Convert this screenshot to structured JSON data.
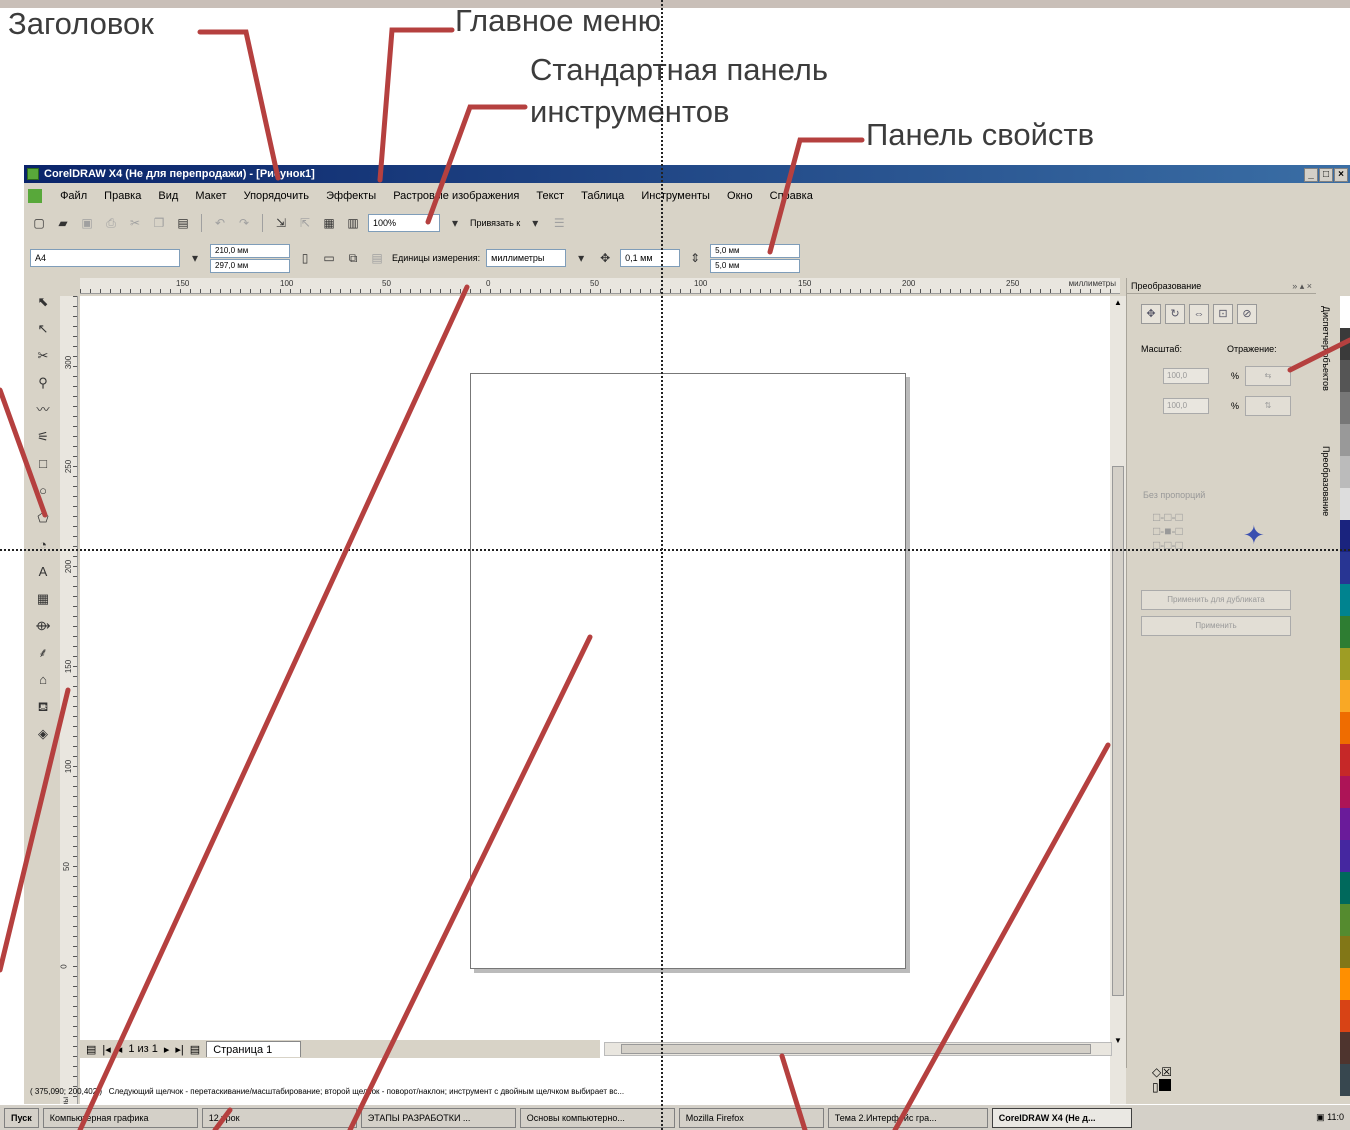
{
  "annotations": {
    "title_label": "Заголовок",
    "main_menu_label": "Главное меню",
    "standard_toolbar_line1": "Стандартная панель",
    "standard_toolbar_line2": "инструментов",
    "property_bar_label": "Панель свойств"
  },
  "window": {
    "title": "CorelDRAW X4 (Не для перепродажи) - [Рисунок1]",
    "controls": [
      "_",
      "□",
      "×"
    ]
  },
  "menu": {
    "items": [
      "Файл",
      "Правка",
      "Вид",
      "Макет",
      "Упорядочить",
      "Эффекты",
      "Растровые изображения",
      "Текст",
      "Таблица",
      "Инструменты",
      "Окно",
      "Справка"
    ]
  },
  "standard_toolbar": {
    "zoom": "100%",
    "snap_label": "Привязать к"
  },
  "property_bar": {
    "paper_size": "A4",
    "width": "210,0 мм",
    "height": "297,0 мм",
    "units_label": "Единицы измерения:",
    "units_value": "миллиметры",
    "nudge": "0,1 мм",
    "dup_x": "5,0 мм",
    "dup_y": "5,0 мм"
  },
  "toolbox": {
    "tools": [
      "pick-icon",
      "shape-icon",
      "crop-icon",
      "zoom-icon",
      "freehand-icon",
      "smart-fill-icon",
      "rectangle-icon",
      "ellipse-icon",
      "polygon-icon",
      "basic-shapes-icon",
      "text-icon",
      "table-icon",
      "interactive-icon",
      "eyedropper-icon",
      "outline-icon",
      "fill-icon",
      "interactive-fill-icon"
    ]
  },
  "rulers": {
    "h_ticks": [
      "150",
      "100",
      "50",
      "0",
      "50",
      "100",
      "150",
      "200",
      "250"
    ],
    "h_unit": "миллиметры",
    "v_ticks": [
      "300",
      "250",
      "200",
      "150",
      "100",
      "50",
      "0"
    ],
    "v_unit": "миллиметры"
  },
  "page_nav": {
    "counter": "1 из 1",
    "tab": "Страница 1"
  },
  "status": {
    "coords": "( 375,090; 200,402 )",
    "message": "Следующий щелчок - перетаскивание/масштабирование; второй щелчок - поворот/наклон; инструмент с двойным щелчком выбирает вс..."
  },
  "docker": {
    "title": "Преобразование",
    "scale_label": "Масштаб:",
    "mirror_label": "Отражение:",
    "x_value": "100,0",
    "y_value": "100,0",
    "percent": "%",
    "proportional": "Без пропорций",
    "apply_dup": "Применить для дубликата",
    "apply": "Применить",
    "side_tab1": "Диспетчер объектов",
    "side_tab2": "Преобразование"
  },
  "palette_colors": [
    "#ffffff",
    "#3a3a3a",
    "#555555",
    "#777777",
    "#999999",
    "#bbbbbb",
    "#dddddd",
    "#1a237e",
    "#283593",
    "#00838f",
    "#2e7d32",
    "#9e9d24",
    "#f9a825",
    "#ef6c00",
    "#c62828",
    "#ad1457",
    "#6a1b9a",
    "#4527a0",
    "#00695c",
    "#558b2f",
    "#827717",
    "#ff8f00",
    "#d84315",
    "#4e342e",
    "#37474f"
  ],
  "taskbar": {
    "start": "Пуск",
    "tasks": [
      "Компьютерная графика",
      "12 урок",
      "ЭТАПЫ РАЗРАБОТКИ ...",
      "Основы компьютерно...",
      "Mozilla Firefox",
      "Тема 2.Интерфейс гра...",
      "CorelDRAW X4 (Не д..."
    ],
    "clock": "11:0"
  }
}
